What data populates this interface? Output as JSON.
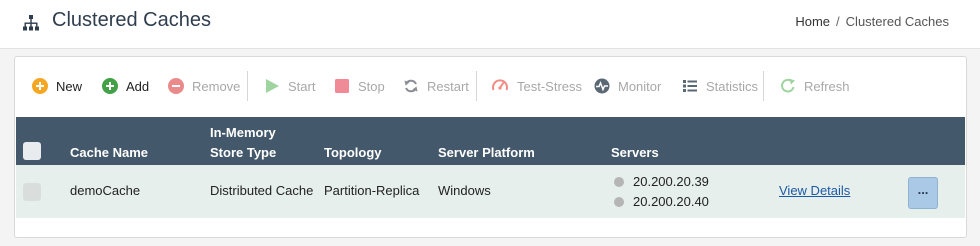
{
  "header": {
    "title": "Clustered Caches",
    "breadcrumb": {
      "home": "Home",
      "separator": "/",
      "current": "Clustered Caches"
    }
  },
  "toolbar": {
    "new": "New",
    "add": "Add",
    "remove": "Remove",
    "start": "Start",
    "stop": "Stop",
    "restart": "Restart",
    "test_stress": "Test-Stress",
    "monitor": "Monitor",
    "statistics": "Statistics",
    "refresh": "Refresh"
  },
  "table": {
    "columns": {
      "cache_name": "Cache Name",
      "store_type_line1": "In-Memory",
      "store_type_line2": "Store Type",
      "topology": "Topology",
      "platform": "Server Platform",
      "servers": "Servers"
    },
    "rows": [
      {
        "cache_name": "demoCache",
        "store_type": "Distributed Cache",
        "topology": "Partition-Replica",
        "platform": "Windows",
        "servers": [
          "20.200.20.39",
          "20.200.20.40"
        ],
        "details_link": "View Details",
        "more": "..."
      }
    ]
  },
  "colors": {
    "header_bg": "#44586b",
    "row_bg": "#e6efec",
    "new_icon": "#f5a623",
    "add_icon": "#43a047",
    "remove_icon": "#e57373",
    "link": "#1d5aa6"
  },
  "icons": {
    "title": "sitemap-icon",
    "new": "plus-circle-icon",
    "add": "plus-circle-icon",
    "remove": "minus-circle-icon",
    "start": "play-icon",
    "stop": "stop-icon",
    "restart": "sync-icon",
    "test_stress": "gauge-icon",
    "monitor": "pulse-icon",
    "statistics": "list-icon",
    "refresh": "refresh-icon"
  }
}
